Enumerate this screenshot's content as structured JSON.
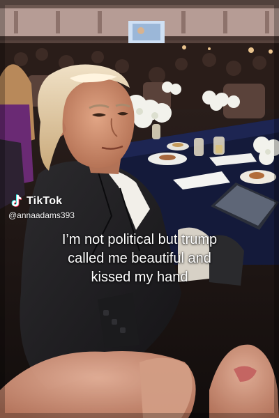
{
  "watermark": {
    "brand": "TikTok",
    "handle": "@annaadams393",
    "logo_icon": "tiktok-logo-icon"
  },
  "caption": {
    "lines": [
      "I’m not political but trump",
      "called me beautiful and",
      "kissed my hand"
    ]
  },
  "colors": {
    "caption_text": "#ffffff",
    "tablecloth": "#141a3a",
    "flowers": "#f2f2ec"
  }
}
